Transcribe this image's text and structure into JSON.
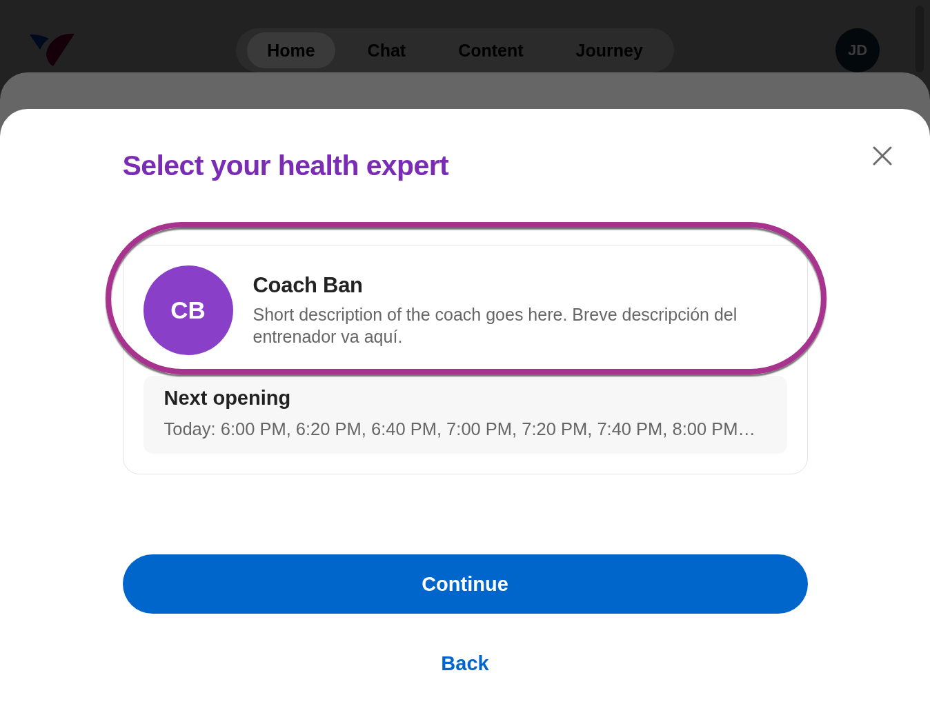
{
  "header": {
    "nav": [
      {
        "label": "Home",
        "selected": true
      },
      {
        "label": "Chat",
        "selected": false
      },
      {
        "label": "Content",
        "selected": false
      },
      {
        "label": "Journey",
        "selected": false
      }
    ],
    "avatar_initials": "JD"
  },
  "dialog": {
    "title": "Select your health expert",
    "experts": [
      {
        "initials": "CB",
        "name": "Coach Ban",
        "description": "Short description of the coach goes here. Breve descripción del entrenador va aquí.",
        "highlighted": true,
        "next_opening": {
          "label": "Next opening",
          "times": "Today: 6:00 PM, 6:20 PM, 6:40 PM, 7:00 PM, 7:20 PM, 7:40 PM, 8:00 PM…"
        }
      }
    ],
    "primary_button": "Continue",
    "secondary_link": "Back"
  }
}
